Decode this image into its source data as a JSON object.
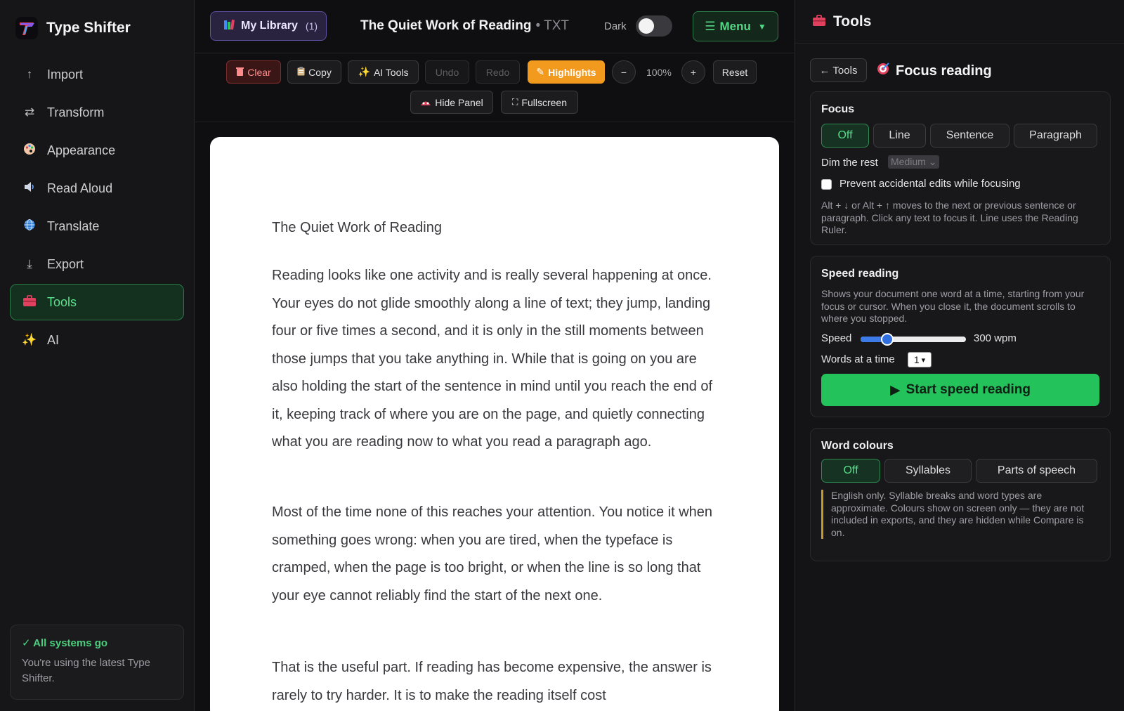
{
  "app": {
    "name": "Type Shifter"
  },
  "sidebar": {
    "items": [
      {
        "label": "Import",
        "icon": "arrow-up-icon"
      },
      {
        "label": "Transform",
        "icon": "swap-arrows-icon"
      },
      {
        "label": "Appearance",
        "icon": "palette-icon"
      },
      {
        "label": "Read Aloud",
        "icon": "speaker-icon"
      },
      {
        "label": "Translate",
        "icon": "globe-icon"
      },
      {
        "label": "Export",
        "icon": "download-arrow-icon"
      },
      {
        "label": "Tools",
        "icon": "toolbox-icon",
        "active": true
      },
      {
        "label": "AI",
        "icon": "sparkles-icon"
      }
    ],
    "status": {
      "title": "✓ All systems go",
      "text": "You're using the latest Type Shifter."
    }
  },
  "header": {
    "library_label": "My Library",
    "library_count": "(1)",
    "doc_title": "The Quiet Work of Reading",
    "doc_type": "• TXT",
    "dark_label": "Dark",
    "dark_on": false,
    "menu_label": "Menu"
  },
  "toolbar": {
    "clear": "Clear",
    "copy": "Copy",
    "ai_tools": "AI Tools",
    "undo": "Undo",
    "redo": "Redo",
    "highlights": "Highlights",
    "zoom_out": "−",
    "zoom": "100%",
    "zoom_in": "+",
    "reset": "Reset",
    "hide_panel": "Hide Panel",
    "fullscreen": "Fullscreen"
  },
  "document": {
    "title": "The Quiet Work of Reading",
    "paragraphs": [
      "Reading looks like one activity and is really several happening at once. Your eyes do not glide smoothly along a line of text; they jump, landing four or five times a second, and it is only in the still moments between those jumps that you take anything in. While that is going on you are also holding the start of the sentence in mind until you reach the end of it, keeping track of where you are on the page, and quietly connecting what you are reading now to what you read a paragraph ago.",
      "Most of the time none of this reaches your attention. You notice it when something goes wrong: when you are tired, when the typeface is cramped, when the page is too bright, or when the line is so long that your eye cannot reliably find the start of the next one.",
      "That is the useful part. If reading has become expensive, the answer is rarely to try harder. It is to make the reading itself cost"
    ]
  },
  "panel": {
    "title": "Tools",
    "back_label": "← Tools",
    "subtitle": "Focus reading",
    "focus": {
      "title": "Focus",
      "options": [
        "Off",
        "Line",
        "Sentence",
        "Paragraph"
      ],
      "selected": "Off",
      "dim_label": "Dim the rest",
      "dim_value": "Medium",
      "prevent_label": "Prevent accidental edits while focusing",
      "help": "Alt + ↓ or Alt + ↑ moves to the next or previous sentence or paragraph. Click any text to focus it. Line uses the Reading Ruler."
    },
    "speed": {
      "title": "Speed reading",
      "desc": "Shows your document one word at a time, starting from your focus or cursor. When you close it, the document scrolls to where you stopped.",
      "speed_label": "Speed",
      "speed_value": "300 wpm",
      "speed_fraction": 0.25,
      "words_label": "Words at a time",
      "words_value": "1",
      "start_label": "Start speed reading"
    },
    "colours": {
      "title": "Word colours",
      "options": [
        "Off",
        "Syllables",
        "Parts of speech"
      ],
      "selected": "Off",
      "note": "English only. Syllable breaks and word types are approximate. Colours show on screen only — they are not included in exports, and they are hidden while Compare is on."
    }
  },
  "colors": {
    "accent_green": "#23c25b",
    "highlight_orange": "#f29a1d",
    "library_purple": "#5e4fa0"
  }
}
